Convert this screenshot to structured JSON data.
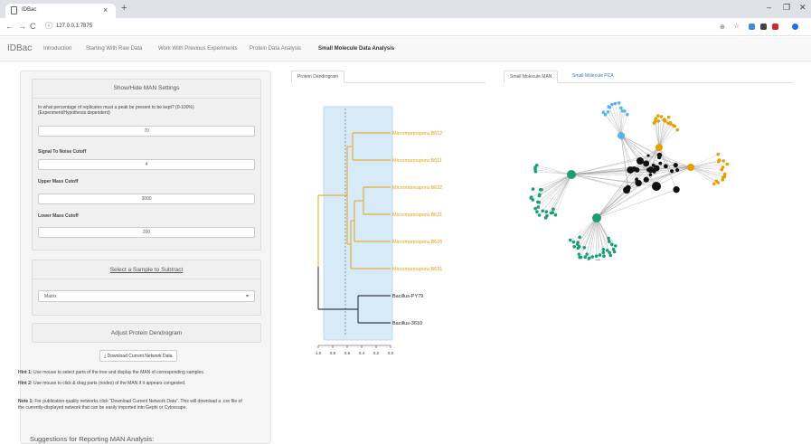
{
  "browser": {
    "tab_title": "IDBac",
    "url": "127.0.0.1:7875"
  },
  "app": {
    "brand": "IDBac",
    "nav": [
      "Introduction",
      "Starting With Raw Data",
      "Work With Previous Experiments",
      "Protein Data Analysis",
      "Small Molecule Data Analysis"
    ],
    "active_nav": "Small Molecule Data Analysis"
  },
  "settings": {
    "title": "Show/Hide MAN Settings",
    "replicate_label": "In what percentage of replicates must a peak be present to be kept? (0-100%) (Experiment/Hypothesis dependent)",
    "replicate_value": "70",
    "snr_label": "Signal To Noise Cutoff",
    "snr_value": "4",
    "upper_label": "Upper Mass Cutoff",
    "upper_value": "3000",
    "lower_label": "Lower Mass Cutoff",
    "lower_value": "200"
  },
  "subtract": {
    "title": "Select a Sample to Subtract",
    "selected": "Matrix"
  },
  "adjust_title": "Adjust Protein Dendrogram",
  "download_label": "Download Current Network Data",
  "hints": {
    "hint1_label": "Hint 1:",
    "hint1_text": "Use mouse to select parts of the tree and display the MAN of corresponding samples.",
    "hint2_label": "Hint 2:",
    "hint2_text": "Use mouse to click & drag parts (nodes) of the MAN if it appears congested.",
    "note1_label": "Note 1:",
    "note1_text": "For publication-quality networks click \"Download Current Network Data\". This will download a .csv file of the currently-displayed network that can be easily imported into Gephi or Cytoscape."
  },
  "suggestions_title": "Suggestions for Reporting MAN Analysis:",
  "dendro_tab": "Protein Dendrogram",
  "network_tabs": [
    "Small Molecule MAN",
    "Small Molecule PCA"
  ],
  "dendrogram": {
    "leaves": [
      {
        "label": "Micromonospora B612",
        "color": "#e69f00"
      },
      {
        "label": "Micromonospora B611",
        "color": "#e69f00"
      },
      {
        "label": "Micromonospora B622",
        "color": "#e69f00"
      },
      {
        "label": "Micromonospora B621",
        "color": "#e69f00"
      },
      {
        "label": "Micromonospora B626",
        "color": "#e69f00"
      },
      {
        "label": "Micromonospora B631",
        "color": "#e69f00"
      },
      {
        "label": "Bacillus-PY79",
        "color": "#222222"
      },
      {
        "label": "Bacillus-3610",
        "color": "#222222"
      }
    ],
    "axis_ticks": [
      "1.0",
      "0.8",
      "0.6",
      "0.4",
      "0.2",
      "0.0"
    ]
  },
  "colors": {
    "orange": "#e69f00",
    "green": "#1b9e77",
    "blue": "#56b4e9",
    "black": "#111111",
    "selection": "#d6eaf8"
  },
  "icons": {
    "download": "download-icon"
  }
}
